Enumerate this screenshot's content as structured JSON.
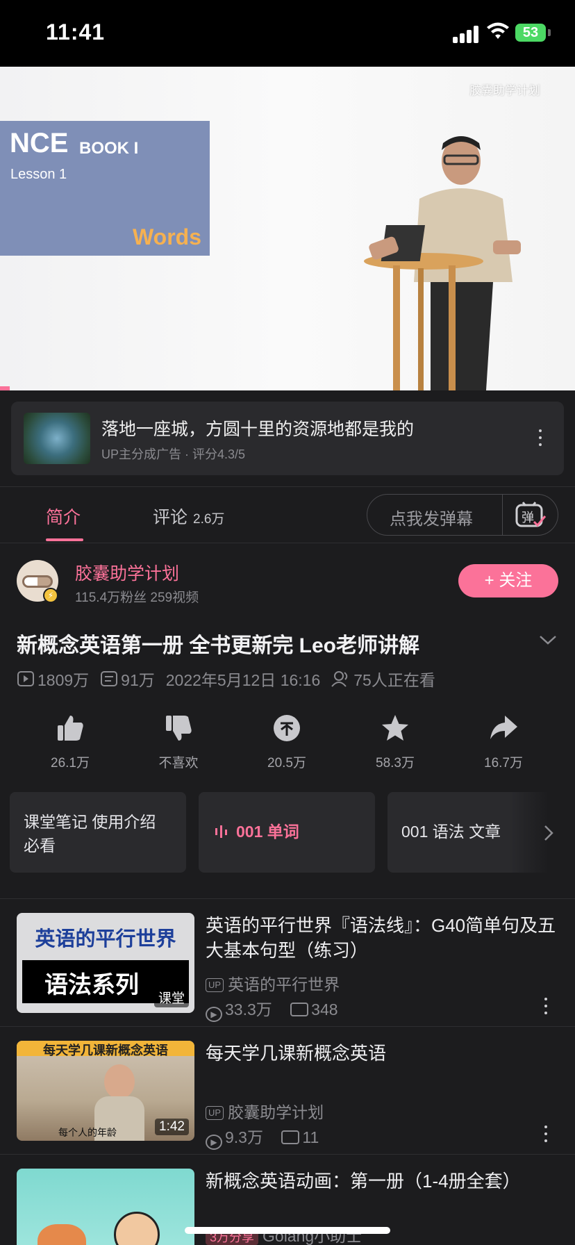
{
  "status": {
    "time": "11:41",
    "battery": "53"
  },
  "video": {
    "watermark": "胶囊助学计划",
    "card": {
      "title": "NCE",
      "book": "BOOK I",
      "lesson": "Lesson 1",
      "words": "Words"
    }
  },
  "ad": {
    "title": "落地一座城，方圆十里的资源地都是我的",
    "subtitle": "UP主分成广告 · 评分4.3/5"
  },
  "tabs": {
    "intro": "简介",
    "comments": "评论",
    "comments_count": "2.6万",
    "danmu_placeholder": "点我发弹幕",
    "danmu_icon_text": "弹"
  },
  "uploader": {
    "name": "胶囊助学计划",
    "stats": "115.4万粉丝   259视频",
    "follow_label": "+ 关注"
  },
  "video_info": {
    "title": "新概念英语第一册 全书更新完 Leo老师讲解",
    "views": "1809万",
    "danmaku": "91万",
    "date": "2022年5月12日 16:16",
    "watching": "75人正在看"
  },
  "actions": [
    {
      "icon": "thumbs-up-icon",
      "label": "26.1万"
    },
    {
      "icon": "thumbs-down-icon",
      "label": "不喜欢"
    },
    {
      "icon": "coin-icon",
      "label": "20.5万"
    },
    {
      "icon": "star-icon",
      "label": "58.3万"
    },
    {
      "icon": "share-icon",
      "label": "16.7万"
    }
  ],
  "episodes": [
    {
      "label": "课堂笔记 使用介绍\n必看"
    },
    {
      "label": "001 单词"
    },
    {
      "label": "001 语法 文章"
    }
  ],
  "recommendations": [
    {
      "title": "英语的平行世界『语法线』：G40简单句及五大基本句型（练习）",
      "up": "英语的平行世界",
      "views": "33.3万",
      "danmaku": "348",
      "thumb_top": "英语的平行世界",
      "thumb_bottom": "语法系列",
      "thumb_tag": "课堂"
    },
    {
      "title": "每天学几课新概念英语",
      "up": "胶囊助学计划",
      "views": "9.3万",
      "danmaku": "11",
      "duration": "1:42",
      "thumb_top": "每天学几课新概念英语",
      "thumb_caption": "每个人的年龄"
    },
    {
      "title": "新概念英语动画：第一册（1-4册全套）",
      "up": "Golang小助士",
      "badge": "3万分享"
    }
  ],
  "colors": {
    "accent": "#fb7299",
    "background": "#1c1c1e",
    "card": "#2a2a2d"
  }
}
